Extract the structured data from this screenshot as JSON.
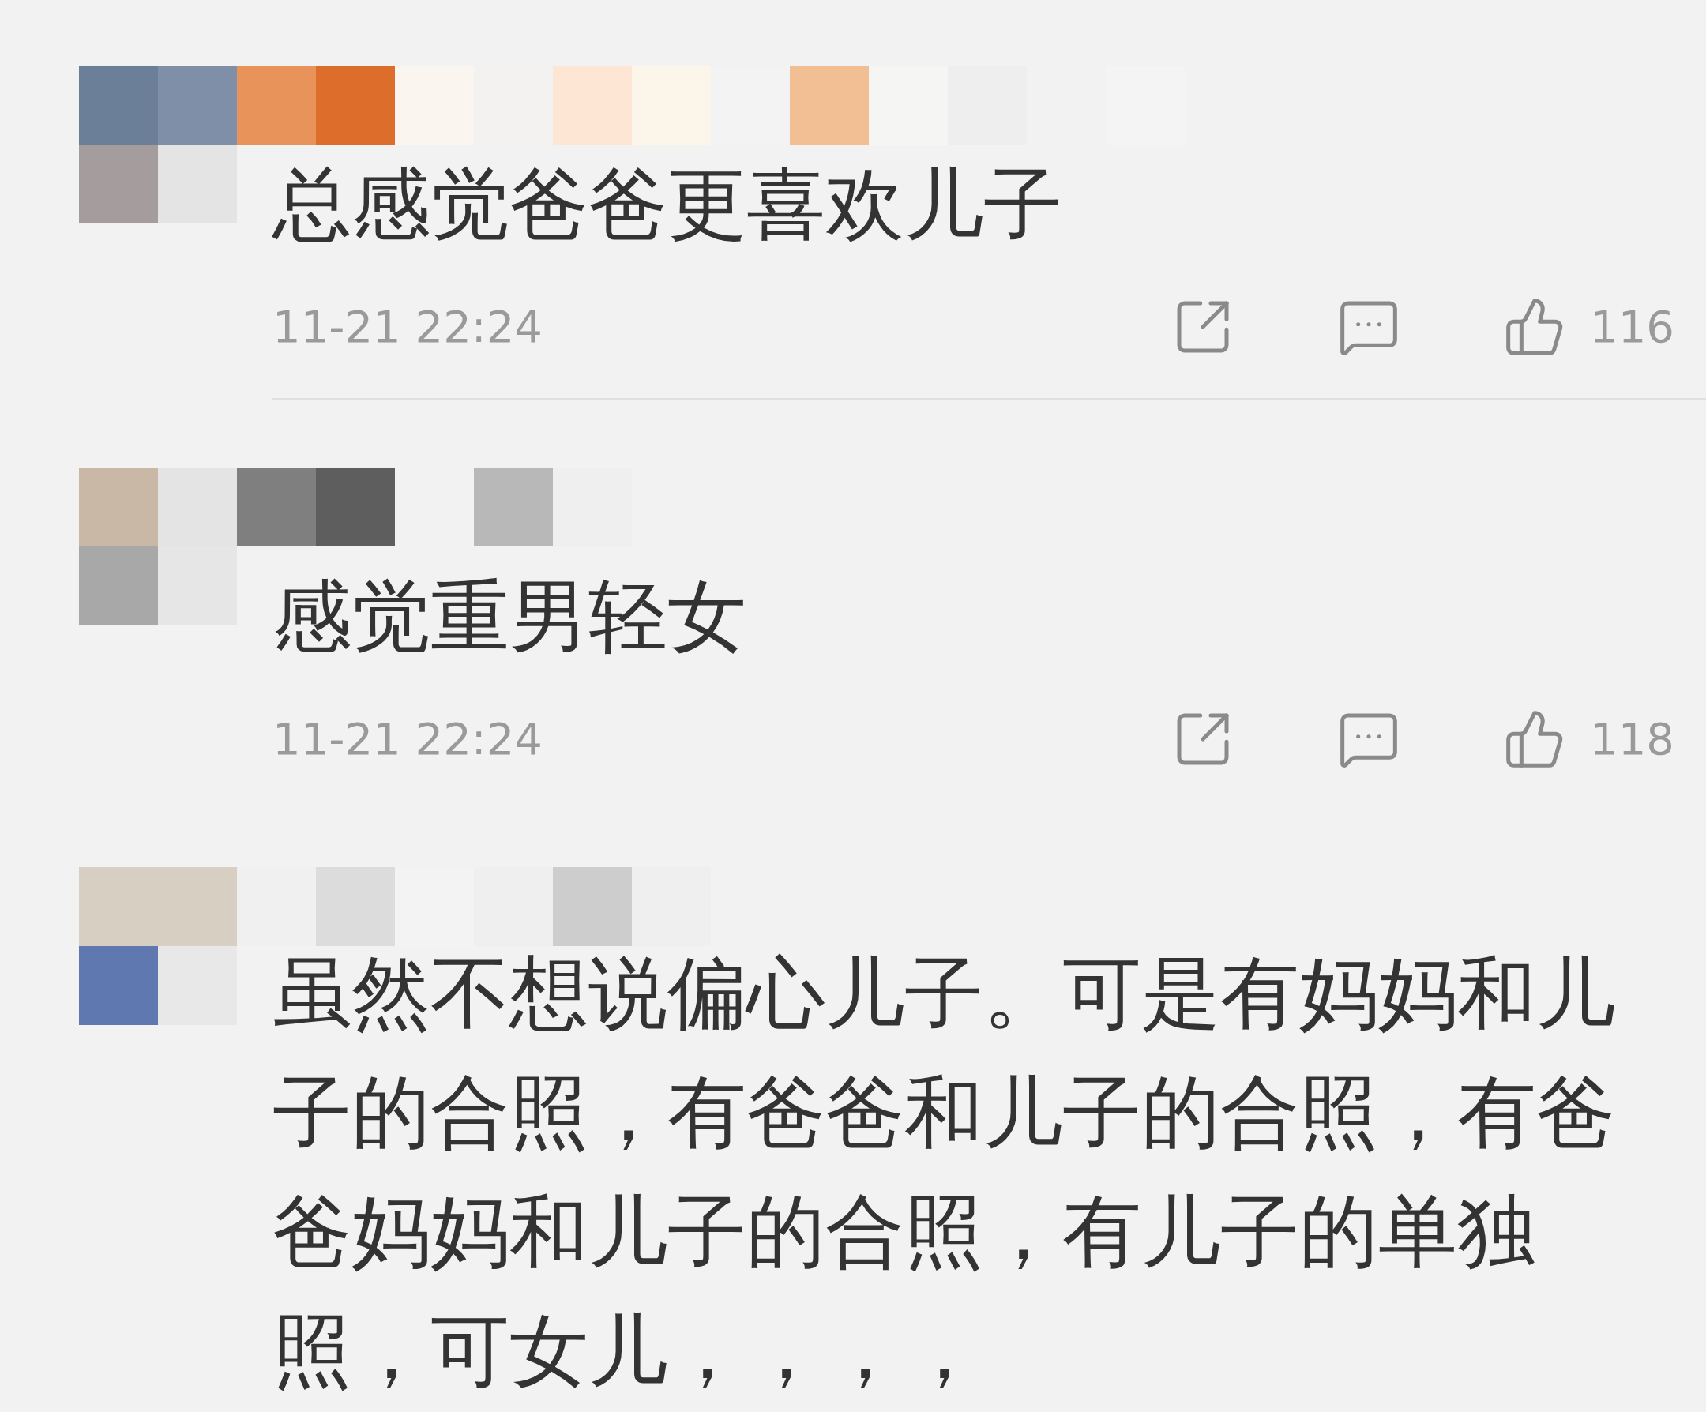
{
  "comments": [
    {
      "text": "总感觉爸爸更喜欢儿子",
      "time": "11-21 22:24",
      "likes": "116",
      "divider_below": true
    },
    {
      "text": "感觉重男轻女",
      "time": "11-21 22:24",
      "likes": "118",
      "divider_below": false
    },
    {
      "text": "虽然不想说偏心儿子。可是有妈妈和儿子的合照，有爸爸和儿子的合照，有爸爸妈妈和儿子的合照，有儿子的单独照，可女儿，，，，"
    }
  ]
}
